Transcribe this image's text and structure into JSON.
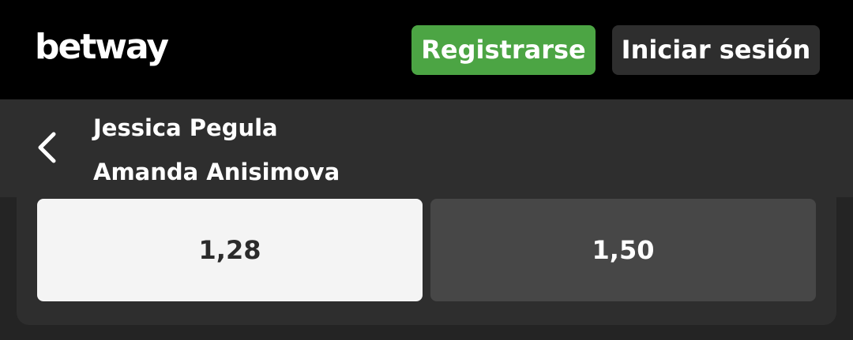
{
  "header": {
    "logo": "betway",
    "register_label": "Registrarse",
    "login_label": "Iniciar sesión",
    "register_color": "#4ca544"
  },
  "match": {
    "back_icon": "chevron-left-icon",
    "player_1": "Jessica Pegula",
    "player_2": "Amanda Anisimova"
  },
  "odds": [
    {
      "value": "1,28",
      "selected": true
    },
    {
      "value": "1,50",
      "selected": false
    }
  ]
}
